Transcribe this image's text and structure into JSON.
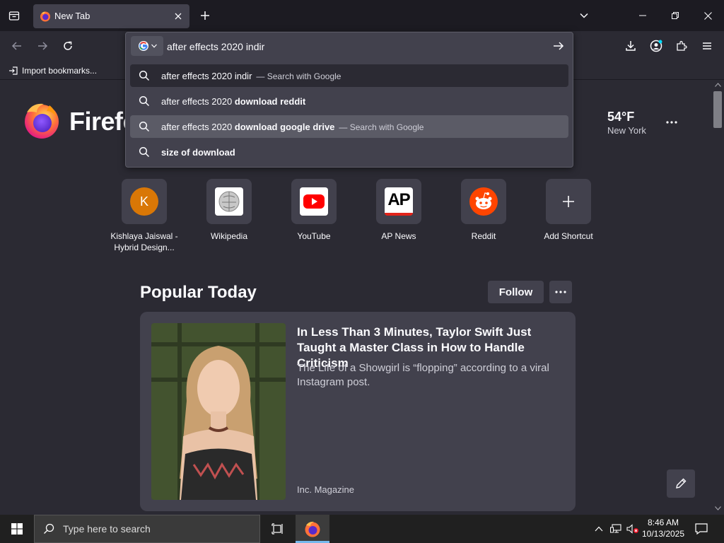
{
  "browser": {
    "tab": {
      "title": "New Tab"
    },
    "bookmarks": {
      "import_label": "Import bookmarks..."
    },
    "url_bar": {
      "value": "after effects 2020 indir",
      "suggestions": [
        {
          "prefix": "after effects 2020 indir",
          "bold": "",
          "action": "— Search with Google"
        },
        {
          "prefix": "after effects 2020 ",
          "bold": "download reddit",
          "action": ""
        },
        {
          "prefix": "after effects 2020 ",
          "bold": "download google drive",
          "action": "— Search with Google"
        },
        {
          "prefix": "",
          "bold": "size of download",
          "action": ""
        }
      ]
    }
  },
  "newtab": {
    "brand": "Firefox",
    "weather": {
      "temp": "54°F",
      "location": "New York"
    },
    "shortcuts": [
      {
        "label": "Kishlaya Jaiswal - Hybrid Design...",
        "initial": "K"
      },
      {
        "label": "Wikipedia"
      },
      {
        "label": "YouTube"
      },
      {
        "label": "AP News",
        "logo_text": "AP"
      },
      {
        "label": "Reddit"
      },
      {
        "label": "Add Shortcut"
      }
    ],
    "popular": {
      "heading": "Popular Today",
      "follow_label": "Follow",
      "story": {
        "title": "In Less Than 3 Minutes, Taylor Swift Just Taught a Master Class in How to Handle Criticism",
        "excerpt": "The Life of a Showgirl is “flopping” according to a viral Instagram post.",
        "source": "Inc. Magazine"
      }
    }
  },
  "taskbar": {
    "search_placeholder": "Type here to search",
    "time": "8:46 AM",
    "date": "10/13/2025"
  },
  "colors": {
    "chrome_bg": "#1c1b22",
    "content_bg": "#2b2a33",
    "card_bg": "#42414d",
    "accent": "#00ddff"
  }
}
